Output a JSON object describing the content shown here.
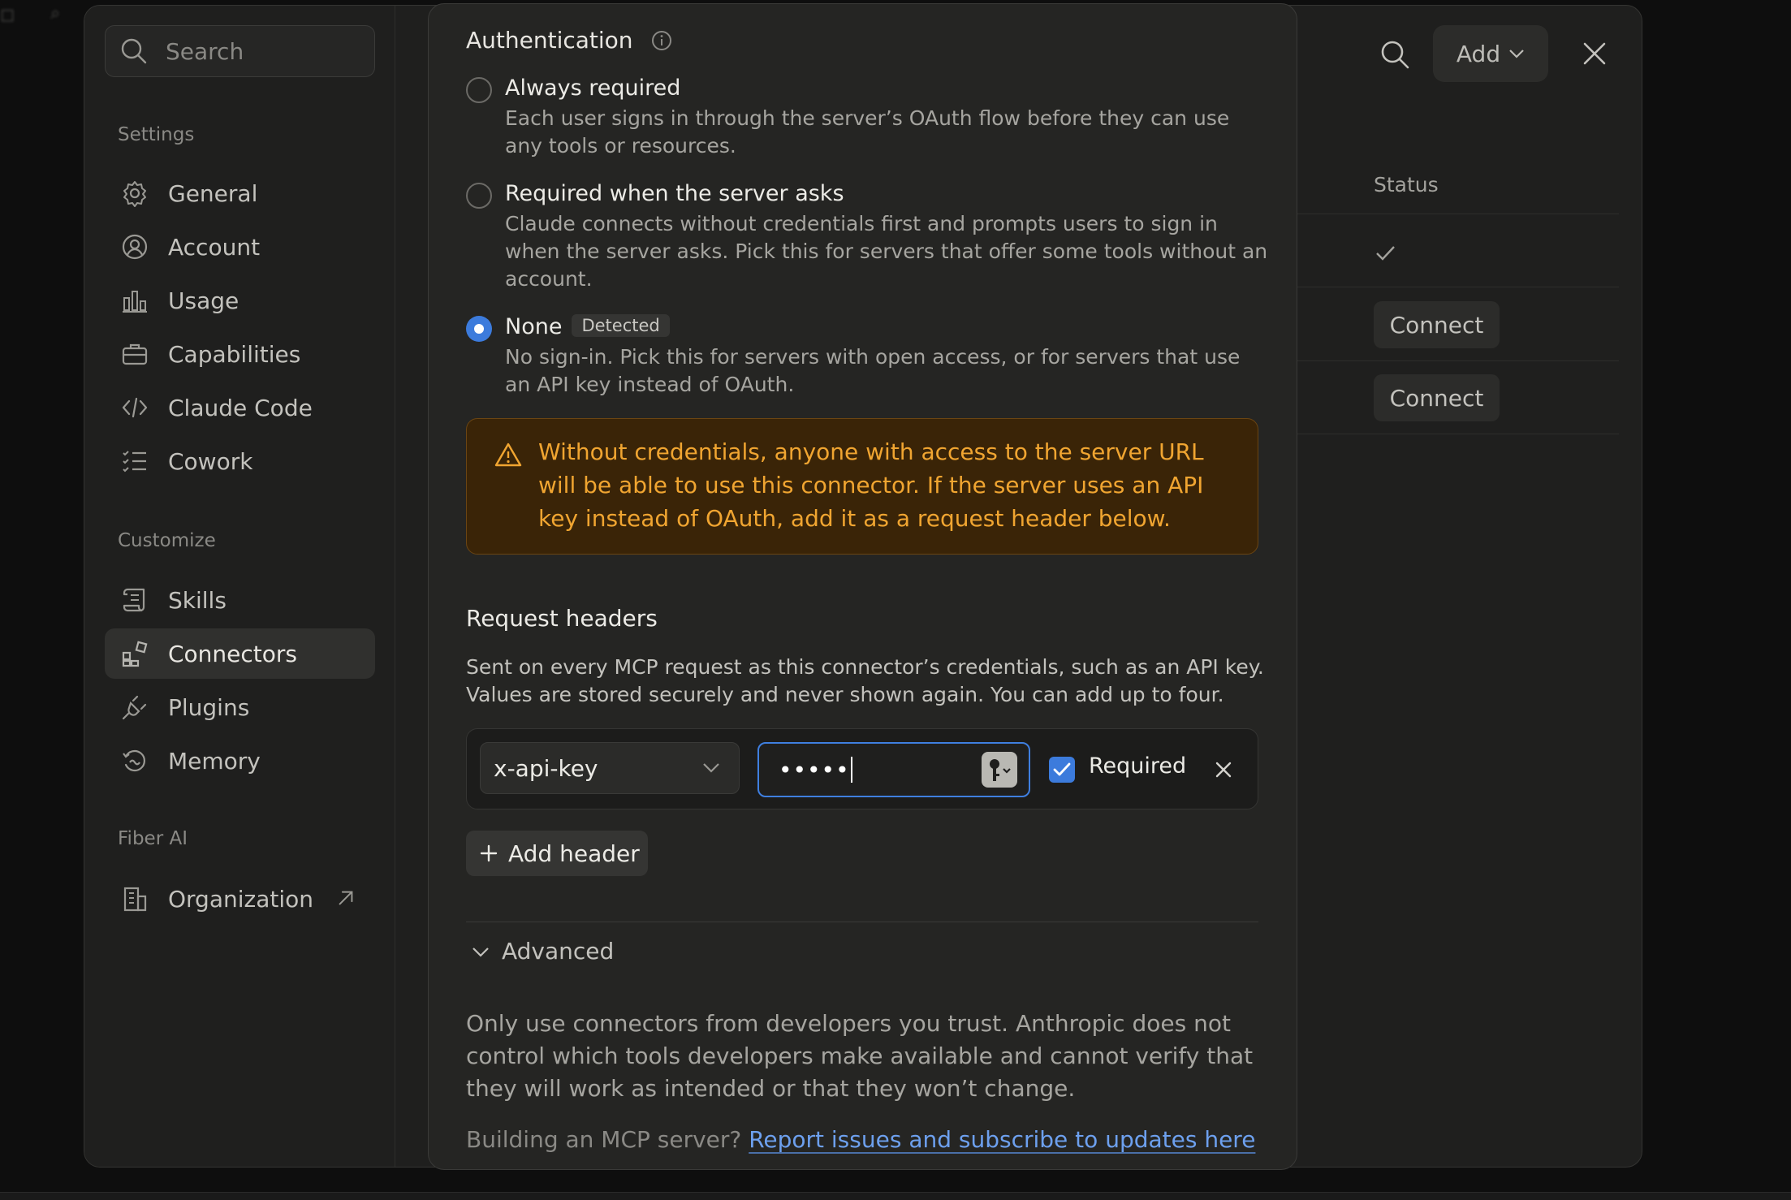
{
  "settings": {
    "search_placeholder": "Search",
    "sections": {
      "settings": "Settings",
      "customize": "Customize",
      "org": "Fiber AI"
    },
    "nav": {
      "general": "General",
      "account": "Account",
      "usage": "Usage",
      "capabilities": "Capabilities",
      "claude_code": "Claude Code",
      "cowork": "Cowork",
      "skills": "Skills",
      "connectors": "Connectors",
      "plugins": "Plugins",
      "memory": "Memory",
      "organization": "Organization"
    },
    "active_nav": "connectors",
    "toolbar": {
      "add_label": "Add"
    },
    "connectors_table": {
      "status_header": "Status",
      "connect_label": "Connect"
    }
  },
  "modal": {
    "auth_title": "Authentication",
    "options": [
      {
        "title": "Always required",
        "desc": "Each user signs in through the server’s OAuth flow before they can use any tools or resources.",
        "selected": false
      },
      {
        "title": "Required when the server asks",
        "desc": "Claude connects without credentials first and prompts users to sign in when the server asks. Pick this for servers that offer some tools without an account.",
        "selected": false
      },
      {
        "title": "None",
        "badge": "Detected",
        "desc": "No sign-in. Pick this for servers with open access, or for servers that use an API key instead of OAuth.",
        "selected": true
      }
    ],
    "warning": "Without credentials, anyone with access to the server URL will be able to use this connector. If the server uses an API key instead of OAuth, add it as a request header below.",
    "request_headers": {
      "title": "Request headers",
      "desc": "Sent on every MCP request as this connector’s credentials, such as an API key. Values are stored securely and never shown again. You can add up to four.",
      "row": {
        "name": "x-api-key",
        "value_masked": "•••••",
        "required_label": "Required",
        "required": true
      },
      "add_label": "Add header"
    },
    "advanced_label": "Advanced",
    "trust_text": "Only use connectors from developers you trust. Anthropic does not control which tools developers make available and cannot verify that they will work as intended or that they won’t change.",
    "building_text": "Building an MCP server?",
    "building_link": "Report issues and subscribe to updates here"
  },
  "colors": {
    "accent": "#3c7bdc",
    "warning_text": "#f0a531",
    "warning_bg": "#3a2407",
    "link": "#6da0ee"
  }
}
